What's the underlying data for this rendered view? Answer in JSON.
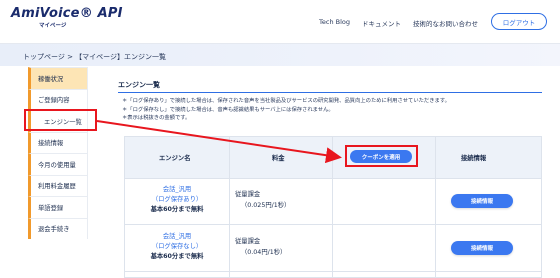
{
  "header": {
    "logo_main": "AmiVoice® API",
    "logo_sub": "マイページ",
    "nav": [
      "Tech Blog",
      "ドキュメント",
      "技術的なお問い合わせ"
    ],
    "logout": "ログアウト"
  },
  "breadcrumb": "トップページ > 【マイページ】エンジン一覧",
  "sidebar": {
    "items": [
      {
        "label": "稼働状況"
      },
      {
        "label": "ご登録内容"
      },
      {
        "label": "エンジン一覧"
      },
      {
        "label": "接続情報"
      },
      {
        "label": "今月の使用量"
      },
      {
        "label": "利用料金履歴"
      },
      {
        "label": "単語登録"
      },
      {
        "label": "退会手続き"
      }
    ]
  },
  "main": {
    "title": "エンジン一覧",
    "notes": [
      "＊「ログ保存あり」で接続した場合は、保存された音声を当社製品及びサービスの研究開発、品質向上のために利用させていただきます。",
      "＊「ログ保存なし」で接続した場合は、音声も認識結果もサーバ上には保存されません。",
      "＊表示は税抜きの金額です。"
    ],
    "table": {
      "headers": {
        "engine": "エンジン名",
        "fee": "料金",
        "coupon": "クーポンを適用",
        "conn": "接続情報"
      },
      "rows": [
        {
          "engine_line1": "会話_汎用",
          "engine_line2": "（ログ保存あり）",
          "engine_line3": "基本60分まで無料",
          "fee_line1": "従量課金",
          "fee_line2": "（0.025円/1秒）",
          "button": "接続情報"
        },
        {
          "engine_line1": "会話_汎用",
          "engine_line2": "（ログ保存なし）",
          "engine_line3": "基本60分まで無料",
          "fee_line1": "従量課金",
          "fee_line2": "（0.04円/1秒）",
          "button": "接続情報"
        }
      ]
    }
  },
  "colors": {
    "accent": "#2f6fe4",
    "highlight": "#e8161e",
    "sidebar_active": "#fde5b5",
    "sidebar_bar": "#f19a2c"
  }
}
